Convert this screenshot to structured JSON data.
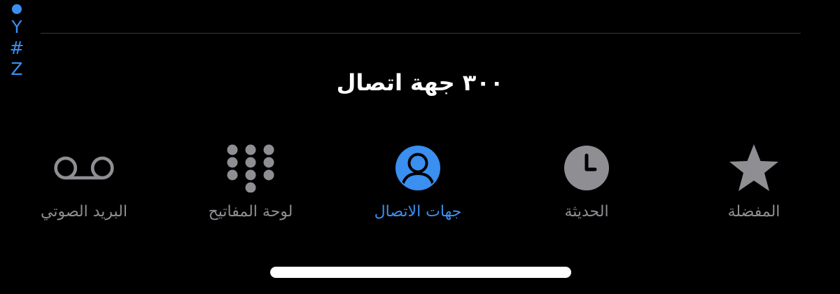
{
  "colors": {
    "accent": "#3a8ff0",
    "inactive": "#8e8e93",
    "background": "#000000",
    "text": "#ffffff"
  },
  "index": {
    "letters": [
      "Y",
      "#",
      "Z"
    ]
  },
  "contacts": {
    "count_text": "٣٠٠ جهة اتصال"
  },
  "tabs": [
    {
      "label": "البريد الصوتي",
      "icon": "voicemail-icon",
      "active": false
    },
    {
      "label": "لوحة المفاتيح",
      "icon": "keypad-icon",
      "active": false
    },
    {
      "label": "جهات الاتصال",
      "icon": "person-circle-icon",
      "active": true
    },
    {
      "label": "الحديثة",
      "icon": "clock-icon",
      "active": false
    },
    {
      "label": "المفضلة",
      "icon": "star-icon",
      "active": false
    }
  ]
}
